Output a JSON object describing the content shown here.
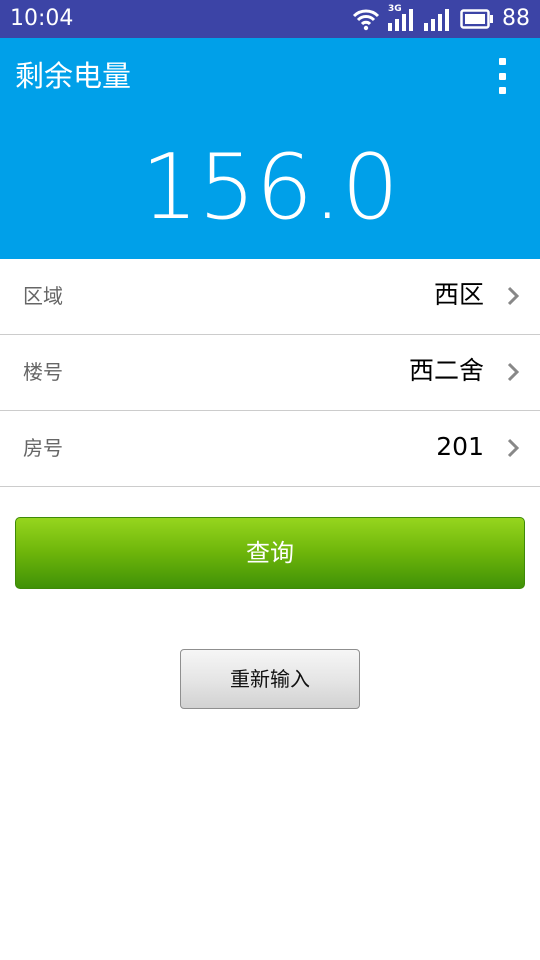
{
  "status_bar": {
    "time": "10:04",
    "network_label": "3G",
    "battery": "88",
    "icons": [
      "wifi-icon",
      "3g-signal-icon",
      "signal-icon",
      "battery-icon"
    ]
  },
  "header": {
    "title": "剩余电量",
    "remaining_value": "156.0",
    "background_color": "#00A0E9",
    "menu_icon": "more-vertical-icon"
  },
  "form": {
    "rows": [
      {
        "label": "区域",
        "value": "西区"
      },
      {
        "label": "楼号",
        "value": "西二舍"
      },
      {
        "label": "房号",
        "value": "201"
      }
    ]
  },
  "actions": {
    "query_label": "查询",
    "reset_label": "重新输入",
    "query_color": "#6DB50A"
  }
}
